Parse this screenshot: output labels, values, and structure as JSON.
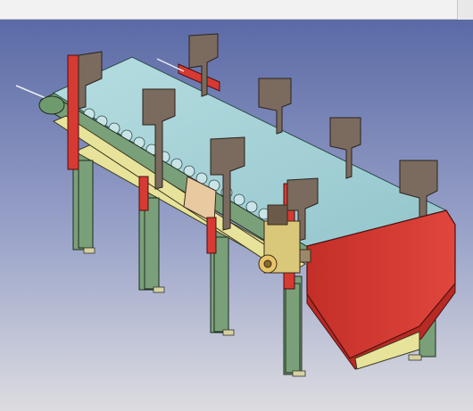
{
  "window": {
    "title": ""
  },
  "viewport": {
    "scene": "conveyor-assembly",
    "background_top": "#5f6fa8",
    "background_bottom": "#d8d8dc"
  },
  "colors": {
    "conveyor_belt": "#a8d3d8",
    "frame_green": "#7aa07a",
    "support_red": "#d63a32",
    "bracket_brown": "#7b6b5e",
    "beam_yellow": "#e8e39a",
    "drive_motor": "#d9c87a"
  }
}
